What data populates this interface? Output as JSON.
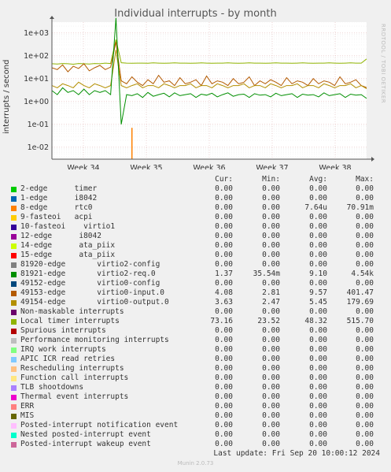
{
  "title": "Individual interrupts - by month",
  "y_axis_label": "interrupts / second",
  "side_text": "RRDTOOL / TOBI OETIKER",
  "legend_headers": {
    "cur": "Cur:",
    "min": "Min:",
    "avg": "Avg:",
    "max": "Max:"
  },
  "legend": [
    {
      "name": "2-edge      timer",
      "color": "#00cc00",
      "cur": "0.00",
      "min": "0.00",
      "avg": "0.00",
      "max": "0.00"
    },
    {
      "name": "1-edge      i8042",
      "color": "#0066b3",
      "cur": "0.00",
      "min": "0.00",
      "avg": "0.00",
      "max": "0.00"
    },
    {
      "name": "8-edge      rtc0",
      "color": "#ff8000",
      "cur": "0.00",
      "min": "0.00",
      "avg": "7.64u",
      "max": "70.91m"
    },
    {
      "name": "9-fasteoi   acpi",
      "color": "#ffcc00",
      "cur": "0.00",
      "min": "0.00",
      "avg": "0.00",
      "max": "0.00"
    },
    {
      "name": "10-fasteoi    virtio1",
      "color": "#330099",
      "cur": "0.00",
      "min": "0.00",
      "avg": "0.00",
      "max": "0.00"
    },
    {
      "name": "12-edge      i8042",
      "color": "#990099",
      "cur": "0.00",
      "min": "0.00",
      "avg": "0.00",
      "max": "0.00"
    },
    {
      "name": "14-edge      ata_piix",
      "color": "#ccff00",
      "cur": "0.00",
      "min": "0.00",
      "avg": "0.00",
      "max": "0.00"
    },
    {
      "name": "15-edge      ata_piix",
      "color": "#ff0000",
      "cur": "0.00",
      "min": "0.00",
      "avg": "0.00",
      "max": "0.00"
    },
    {
      "name": "81920-edge       virtio2-config",
      "color": "#808080",
      "cur": "0.00",
      "min": "0.00",
      "avg": "0.00",
      "max": "0.00"
    },
    {
      "name": "81921-edge       virtio2-req.0",
      "color": "#008f00",
      "cur": "1.37",
      "min": "35.54m",
      "avg": "9.10",
      "max": "4.54k"
    },
    {
      "name": "49152-edge       virtio0-config",
      "color": "#00487d",
      "cur": "0.00",
      "min": "0.00",
      "avg": "0.00",
      "max": "0.00"
    },
    {
      "name": "49153-edge       virtio0-input.0",
      "color": "#b35a00",
      "cur": "4.08",
      "min": "2.81",
      "avg": "9.57",
      "max": "401.47"
    },
    {
      "name": "49154-edge       virtio0-output.0",
      "color": "#b38f00",
      "cur": "3.63",
      "min": "2.47",
      "avg": "5.45",
      "max": "179.69"
    },
    {
      "name": "Non-maskable interrupts",
      "color": "#6b006b",
      "cur": "0.00",
      "min": "0.00",
      "avg": "0.00",
      "max": "0.00"
    },
    {
      "name": "Local timer interrupts",
      "color": "#8fb300",
      "cur": "73.16",
      "min": "23.52",
      "avg": "48.32",
      "max": "515.70"
    },
    {
      "name": "Spurious interrupts",
      "color": "#b30000",
      "cur": "0.00",
      "min": "0.00",
      "avg": "0.00",
      "max": "0.00"
    },
    {
      "name": "Performance monitoring interrupts",
      "color": "#bebebe",
      "cur": "0.00",
      "min": "0.00",
      "avg": "0.00",
      "max": "0.00"
    },
    {
      "name": "IRQ work interrupts",
      "color": "#80ff80",
      "cur": "0.00",
      "min": "0.00",
      "avg": "0.00",
      "max": "0.00"
    },
    {
      "name": "APIC ICR read retries",
      "color": "#80c9ff",
      "cur": "0.00",
      "min": "0.00",
      "avg": "0.00",
      "max": "0.00"
    },
    {
      "name": "Rescheduling interrupts",
      "color": "#ffc080",
      "cur": "0.00",
      "min": "0.00",
      "avg": "0.00",
      "max": "0.00"
    },
    {
      "name": "Function call interrupts",
      "color": "#ffe680",
      "cur": "0.00",
      "min": "0.00",
      "avg": "0.00",
      "max": "0.00"
    },
    {
      "name": "TLB shootdowns",
      "color": "#aa80ff",
      "cur": "0.00",
      "min": "0.00",
      "avg": "0.00",
      "max": "0.00"
    },
    {
      "name": "Thermal event interrupts",
      "color": "#ee00cc",
      "cur": "0.00",
      "min": "0.00",
      "avg": "0.00",
      "max": "0.00"
    },
    {
      "name": "ERR",
      "color": "#ff8080",
      "cur": "0.00",
      "min": "0.00",
      "avg": "0.00",
      "max": "0.00"
    },
    {
      "name": "MIS",
      "color": "#666600",
      "cur": "0.00",
      "min": "0.00",
      "avg": "0.00",
      "max": "0.00"
    },
    {
      "name": "Posted-interrupt notification event",
      "color": "#ffbfff",
      "cur": "0.00",
      "min": "0.00",
      "avg": "0.00",
      "max": "0.00"
    },
    {
      "name": "Nested posted-interrupt event",
      "color": "#00ffcc",
      "cur": "0.00",
      "min": "0.00",
      "avg": "0.00",
      "max": "0.00"
    },
    {
      "name": "Posted-interrupt wakeup event",
      "color": "#cc6699",
      "cur": "0.00",
      "min": "0.00",
      "avg": "0.00",
      "max": "0.00"
    }
  ],
  "last_update": "Last update: Fri Sep 20 10:00:12 2024",
  "footer": "Munin 2.0.73",
  "chart_data": {
    "type": "line",
    "y_scale": "log",
    "ylim": [
      0.003,
      3000
    ],
    "y_ticks": [
      "1e-02",
      "1e-01",
      "1e+00",
      "1e+01",
      "1e+02",
      "1e+03"
    ],
    "x_ticks": [
      "Week 34",
      "Week 35",
      "Week 36",
      "Week 37",
      "Week 38"
    ],
    "grid": true,
    "series": [
      {
        "name": "Local timer interrupts",
        "color": "#8fb300",
        "values": [
          45,
          44,
          46,
          45,
          43,
          46,
          45,
          44,
          46,
          45,
          48,
          46,
          515,
          50,
          48,
          47,
          48,
          48,
          47,
          49,
          48,
          47,
          48,
          49,
          48,
          48,
          47,
          48,
          49,
          48,
          47,
          48,
          48,
          49,
          48,
          47,
          48,
          49,
          48,
          48,
          47,
          48,
          49,
          48,
          48,
          47,
          48,
          49,
          48,
          47,
          48,
          48,
          49,
          48,
          47,
          48,
          49,
          48,
          48,
          73
        ]
      },
      {
        "name": "49153-edge       virtio0-input.0",
        "color": "#b35a00",
        "values": [
          30,
          25,
          40,
          20,
          35,
          28,
          45,
          22,
          30,
          38,
          25,
          32,
          401,
          8,
          6,
          12,
          7,
          5,
          9,
          6,
          14,
          7,
          8,
          5,
          11,
          6,
          7,
          9,
          5,
          13,
          6,
          8,
          7,
          5,
          10,
          6,
          7,
          12,
          5,
          8,
          6,
          9,
          7,
          5,
          11,
          6,
          8,
          7,
          5,
          10,
          6,
          8,
          7,
          5,
          12,
          6,
          7,
          9,
          5,
          4.08
        ]
      },
      {
        "name": "49154-edge       virtio0-output.0",
        "color": "#b38f00",
        "values": [
          5,
          4,
          6,
          5,
          4,
          7,
          5,
          4,
          6,
          5,
          4,
          5,
          180,
          5,
          4,
          5,
          6,
          4,
          5,
          5,
          4,
          6,
          5,
          4,
          5,
          5,
          6,
          4,
          5,
          5,
          4,
          6,
          5,
          4,
          5,
          5,
          6,
          4,
          5,
          5,
          4,
          6,
          5,
          4,
          5,
          5,
          6,
          4,
          5,
          5,
          4,
          6,
          5,
          4,
          5,
          5,
          6,
          4,
          5,
          3.63
        ]
      },
      {
        "name": "81921-edge       virtio2-req.0",
        "color": "#008f00",
        "values": [
          3,
          2,
          4,
          2.5,
          3,
          2,
          3.5,
          2,
          3,
          2.5,
          3,
          2,
          4540,
          0.1,
          2,
          1.8,
          2.2,
          1.5,
          2.5,
          1.7,
          2,
          2.3,
          1.6,
          2.4,
          1.8,
          2,
          2.2,
          1.5,
          2.1,
          1.9,
          2.3,
          1.6,
          2,
          2.4,
          1.7,
          2,
          2.1,
          1.5,
          2.2,
          1.9,
          2,
          1.6,
          2.3,
          1.8,
          2,
          2.2,
          1.5,
          2.1,
          1.9,
          2,
          1.6,
          2.4,
          1.8,
          2,
          2.2,
          1.5,
          2.1,
          1.9,
          2,
          1.37
        ]
      },
      {
        "name": "8-edge      rtc0",
        "color": "#ff8000",
        "values": [
          0,
          0,
          0,
          0,
          0,
          0,
          0,
          0,
          0,
          0,
          0,
          0,
          0,
          0,
          0,
          0.0709,
          0,
          0,
          0,
          0,
          0,
          0,
          0,
          0,
          0,
          0,
          0,
          0,
          0,
          0,
          0,
          0,
          0,
          0,
          0,
          0,
          0,
          0,
          0,
          0,
          0,
          0,
          0,
          0,
          0,
          0,
          0,
          0,
          0,
          0,
          0,
          0,
          0,
          0,
          0,
          0,
          0,
          0,
          0,
          0
        ]
      }
    ]
  }
}
